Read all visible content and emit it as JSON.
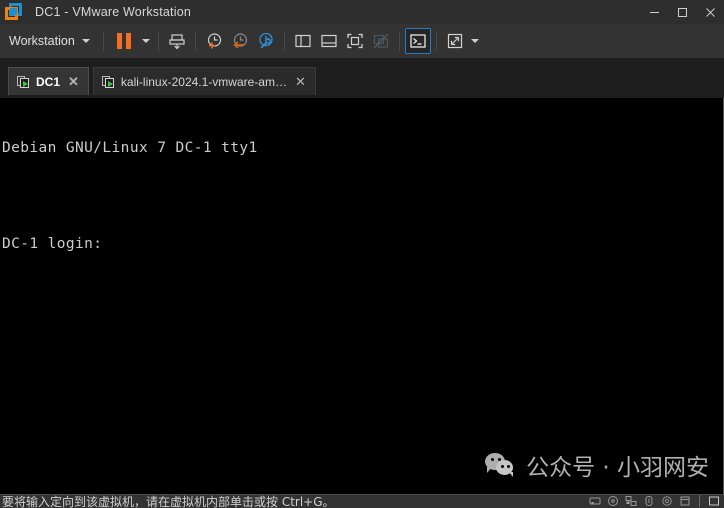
{
  "window": {
    "title": "DC1 - VMware Workstation",
    "logo_icon": "vmware-logo-icon",
    "controls": [
      {
        "name": "minimize-button",
        "icon": "minimize-icon",
        "label": "—"
      },
      {
        "name": "maximize-button",
        "icon": "maximize-icon",
        "label": "□"
      },
      {
        "name": "close-button",
        "icon": "close-icon",
        "label": "✕"
      }
    ]
  },
  "toolbar": {
    "menu_label": "Workstation",
    "menu_caret_icon": "chevron-down-icon",
    "buttons": [
      {
        "name": "suspend-button",
        "icon": "pause-icon",
        "tip": "Suspend"
      },
      {
        "name": "power-dropdown-button",
        "icon": "chevron-down-icon",
        "tip": "Power"
      },
      {
        "name": "send-ctrl-alt-del-button",
        "icon": "send-keys-icon",
        "tip": "Send Ctrl+Alt+Del"
      },
      {
        "name": "take-snapshot-button",
        "icon": "snapshot-add-icon",
        "tip": "Take snapshot"
      },
      {
        "name": "revert-snapshot-button",
        "icon": "snapshot-revert-icon",
        "tip": "Revert to snapshot"
      },
      {
        "name": "manage-snapshots-button",
        "icon": "snapshot-manager-icon",
        "tip": "Manage snapshots"
      },
      {
        "name": "show-library-button",
        "icon": "library-pane-icon",
        "tip": "Show library"
      },
      {
        "name": "show-thumbnails-button",
        "icon": "thumbnail-bar-icon",
        "tip": "Show thumbnails"
      },
      {
        "name": "fullscreen-button",
        "icon": "fullscreen-icon",
        "tip": "Enter full screen"
      },
      {
        "name": "unity-mode-button",
        "icon": "unity-mode-icon",
        "tip": "Unity mode",
        "disabled": true
      },
      {
        "name": "console-view-button",
        "icon": "console-view-icon",
        "tip": "Console view",
        "active": true
      },
      {
        "name": "stretch-view-button",
        "icon": "stretch-arrows-icon",
        "tip": "Stretch guest"
      },
      {
        "name": "view-dropdown-button",
        "icon": "chevron-down-icon",
        "tip": "View options"
      }
    ]
  },
  "tabs": [
    {
      "name": "tab-dc1",
      "label": "DC1",
      "icon": "vm-running-icon",
      "close_icon": "close-icon",
      "close_label": "✕",
      "active": true
    },
    {
      "name": "tab-kali",
      "label": "kali-linux-2024.1-vmware-am…",
      "icon": "vm-running-icon",
      "close_icon": "close-icon",
      "close_label": "✕",
      "active": false
    }
  ],
  "console": {
    "line1": "Debian GNU/Linux 7 DC-1 tty1",
    "line2": "DC-1 login:"
  },
  "watermark": {
    "icon": "wechat-icon",
    "text": "公众号 · 小羽网安"
  },
  "statusbar": {
    "message": "要将输入定向到该虚拟机，请在虚拟机内部单击或按 Ctrl+G。",
    "devices": [
      {
        "name": "status-hard-disk-icon",
        "icon": "hard-disk-icon"
      },
      {
        "name": "status-cd-dvd-icon",
        "icon": "cd-dvd-icon"
      },
      {
        "name": "status-network-icon",
        "icon": "network-adapter-icon"
      },
      {
        "name": "status-usb-icon",
        "icon": "usb-icon"
      },
      {
        "name": "status-sound-icon",
        "icon": "sound-card-icon"
      },
      {
        "name": "status-printer-icon",
        "icon": "printer-icon"
      },
      {
        "name": "status-display-icon",
        "icon": "display-icon"
      }
    ]
  },
  "colors": {
    "accent_orange": "#f4701f",
    "accent_blue": "#2a7bbd",
    "titlebar_bg": "#2e2e2e",
    "toolbar_bg": "#333333",
    "tabbar_bg": "#1e1e1e",
    "console_bg": "#000000",
    "terminal_fg": "#cccccc"
  }
}
